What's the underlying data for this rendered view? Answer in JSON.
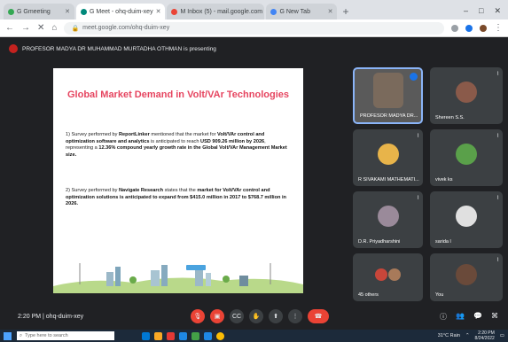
{
  "browser": {
    "tabs": [
      {
        "label": "G Gmeeting",
        "color": "#34a853"
      },
      {
        "label": "G Meet - ohq-duim-xey",
        "color": "#00897b",
        "active": true
      },
      {
        "label": "M Inbox (5) - mail.google.com",
        "color": "#ea4335"
      },
      {
        "label": "G New Tab",
        "color": "#4285f4"
      }
    ],
    "url": "meet.google.com/ohq-duim-xey",
    "window_controls": [
      "–",
      "□",
      "✕"
    ]
  },
  "meet": {
    "presenter_text": "PROFESOR MADYA DR MUHAMMAD MURTADHA OTHMAN is presenting",
    "time": "2:20 PM",
    "meeting_code": "ohq-duim-xey",
    "time_and_code": "2:20 PM   |   ohq-duim-xey"
  },
  "slide": {
    "title": "Global Market Demand in Volt/VAr Technologies",
    "item1_prefix": "1) Survey performed by ",
    "item1_bold1": "ReportLinker",
    "item1_text1": " mentioned that the market for ",
    "item1_bold2": "Volt/VAr control and optimization software and analytics",
    "item1_text2": " is anticipated to reach ",
    "item1_bold3": "USD 909.26 million by 2026",
    "item1_text3": ", representing a ",
    "item1_bold4": "12.36% compound yearly growth rate in the Global Volt/VAr Management Market size.",
    "item2_prefix": "2) Survey performed by ",
    "item2_bold1": "Navigate Research",
    "item2_text1": " states that the ",
    "item2_bold2": "market for Volt/VAr control and optimization solutions is anticipated to expand from $415.0 million in 2017 to $768.7 million in 2026."
  },
  "participants": [
    {
      "name": "PROFESOR MADYA DR...",
      "color": "#7a6a5c"
    },
    {
      "name": "Shereen S.S.",
      "color": "#8a5a4a"
    },
    {
      "name": "R SIVAKAMI MATHEMATI...",
      "color": "#e8b44a"
    },
    {
      "name": "vivek ks",
      "color": "#5aa04a"
    },
    {
      "name": "D.R. Priyadharshini",
      "color": "#9a8a9a"
    },
    {
      "name": "sarida l",
      "color": "#e0e0e0"
    },
    {
      "name": "45 others",
      "color": "#c8463a"
    },
    {
      "name": "You",
      "color": "#6a4a3a"
    }
  ],
  "controls": {
    "icons": [
      "mic-off",
      "camera-off",
      "captions",
      "hand",
      "present",
      "more",
      "end-call"
    ],
    "right_icons": [
      "info",
      "people",
      "chat",
      "activities"
    ]
  },
  "taskbar": {
    "search_placeholder": "Type here to search",
    "weather": "31°C Rain",
    "clock_time": "2:20 PM",
    "clock_date": "8/24/2022",
    "app_colors": [
      "#0078d4",
      "#f9a825",
      "#e53935",
      "#1e88e5",
      "#43a047",
      "#1e88e5",
      "#fbbc04"
    ]
  }
}
